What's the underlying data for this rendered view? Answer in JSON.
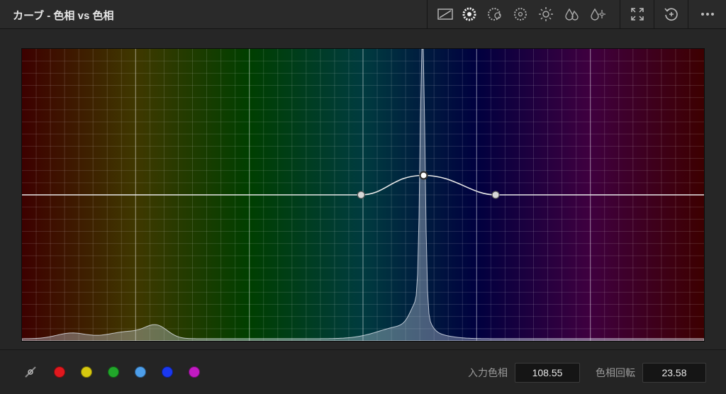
{
  "panel": {
    "title": "カーブ - 色相 vs 色相"
  },
  "toolbar": {
    "mode_icons": [
      "custom-curve-icon",
      "hue-vs-hue-icon",
      "hue-vs-sat-icon",
      "hue-vs-lum-icon",
      "lum-vs-sat-icon",
      "sat-vs-sat-icon",
      "sat-vs-lum-icon"
    ],
    "active_mode": "hue-vs-hue-icon",
    "expand_icon": "expand-icon",
    "reset_icon": "reset-icon",
    "more_icon": "more-options-icon"
  },
  "curve": {
    "points": [
      {
        "hue": 179.0,
        "shift": 0.0
      },
      {
        "hue": 212.0,
        "shift": 11.0
      },
      {
        "hue": 250.0,
        "shift": 0.0
      }
    ],
    "selected_point": 1
  },
  "swatches": [
    {
      "name": "red",
      "color": "#e0181e"
    },
    {
      "name": "yellow",
      "color": "#d7c80f"
    },
    {
      "name": "green",
      "color": "#21a62a"
    },
    {
      "name": "cyan",
      "color": "#4d9eea"
    },
    {
      "name": "blue",
      "color": "#1a38f0"
    },
    {
      "name": "magenta",
      "color": "#c21ac2"
    }
  ],
  "fields": {
    "input_hue_label": "入力色相",
    "input_hue_value": "108.55",
    "hue_rotate_label": "色相回転",
    "hue_rotate_value": "23.58"
  }
}
